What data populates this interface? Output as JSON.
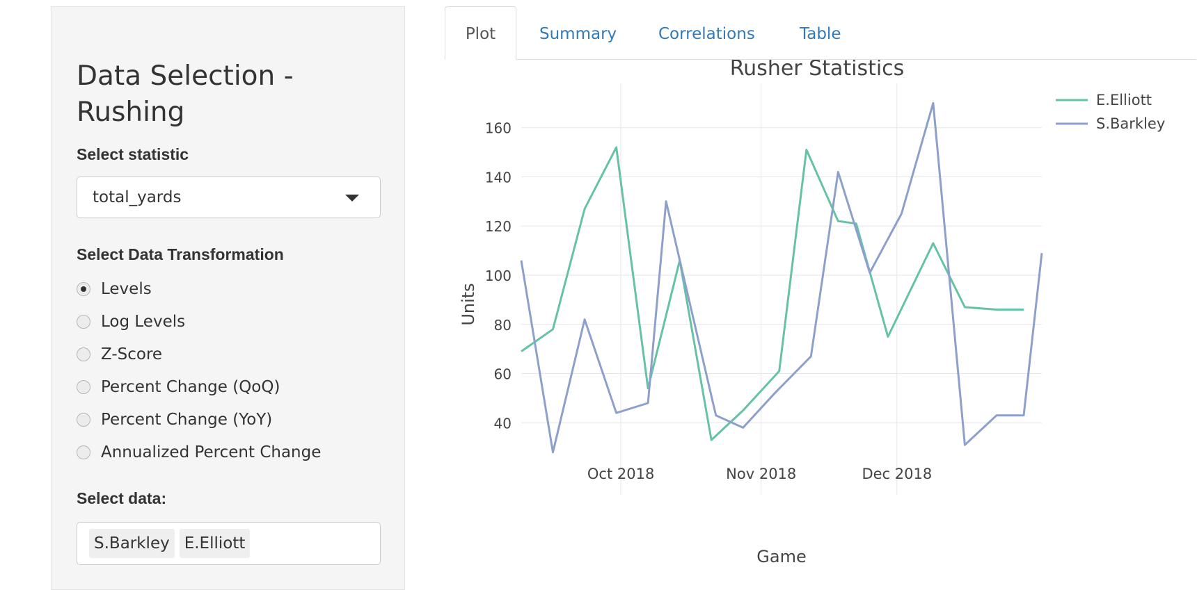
{
  "sidebar": {
    "title": "Data Selection - Rushing",
    "statistic": {
      "label": "Select statistic",
      "selected": "total_yards"
    },
    "transformation": {
      "label": "Select Data Transformation",
      "options": [
        {
          "label": "Levels",
          "selected": true
        },
        {
          "label": "Log Levels",
          "selected": false
        },
        {
          "label": "Z-Score",
          "selected": false
        },
        {
          "label": "Percent Change (QoQ)",
          "selected": false
        },
        {
          "label": "Percent Change (YoY)",
          "selected": false
        },
        {
          "label": "Annualized Percent Change",
          "selected": false
        }
      ]
    },
    "data_select": {
      "label": "Select data:",
      "chips": [
        "S.Barkley",
        "E.Elliott"
      ]
    }
  },
  "tabs": [
    {
      "label": "Plot",
      "active": true
    },
    {
      "label": "Summary",
      "active": false
    },
    {
      "label": "Correlations",
      "active": false
    },
    {
      "label": "Table",
      "active": false
    }
  ],
  "colors": {
    "elliott": "#66c2a5",
    "barkley": "#8da0cb",
    "link": "#337ab7"
  },
  "chart_data": {
    "type": "line",
    "title": "Rusher Statistics",
    "xlabel": "Game",
    "ylabel": "Units",
    "x_tick_labels": [
      "Oct 2018",
      "Nov 2018",
      "Dec 2018"
    ],
    "x_ticks": [
      "2018-10-01",
      "2018-11-01",
      "2018-12-01"
    ],
    "xlim": [
      "2018-09-09",
      "2019-01-02"
    ],
    "ylim": [
      22,
      178
    ],
    "y_ticks": [
      40,
      60,
      80,
      100,
      120,
      140,
      160
    ],
    "grid": true,
    "legend_position": "top-right",
    "series": [
      {
        "name": "E.Elliott",
        "color": "#66c2a5",
        "x": [
          "2018-09-09",
          "2018-09-16",
          "2018-09-23",
          "2018-09-30",
          "2018-10-07",
          "2018-10-14",
          "2018-10-21",
          "2018-10-28",
          "2018-11-05",
          "2018-11-11",
          "2018-11-18",
          "2018-11-22",
          "2018-11-29",
          "2018-12-09",
          "2018-12-16",
          "2018-12-23",
          "2018-12-29"
        ],
        "y": [
          69,
          78,
          127,
          152,
          54,
          106,
          33,
          45,
          61,
          151,
          122,
          121,
          75,
          113,
          87,
          86,
          86
        ]
      },
      {
        "name": "S.Barkley",
        "color": "#8da0cb",
        "x": [
          "2018-09-09",
          "2018-09-16",
          "2018-09-23",
          "2018-09-30",
          "2018-10-07",
          "2018-10-11",
          "2018-10-22",
          "2018-10-28",
          "2018-11-04",
          "2018-11-12",
          "2018-11-18",
          "2018-11-25",
          "2018-12-02",
          "2018-12-09",
          "2018-12-16",
          "2018-12-23",
          "2018-12-29",
          "2019-01-02"
        ],
        "y": [
          106,
          28,
          82,
          44,
          48,
          130,
          43,
          38,
          52,
          67,
          142,
          101,
          125,
          170,
          31,
          43,
          43,
          109
        ]
      }
    ]
  }
}
